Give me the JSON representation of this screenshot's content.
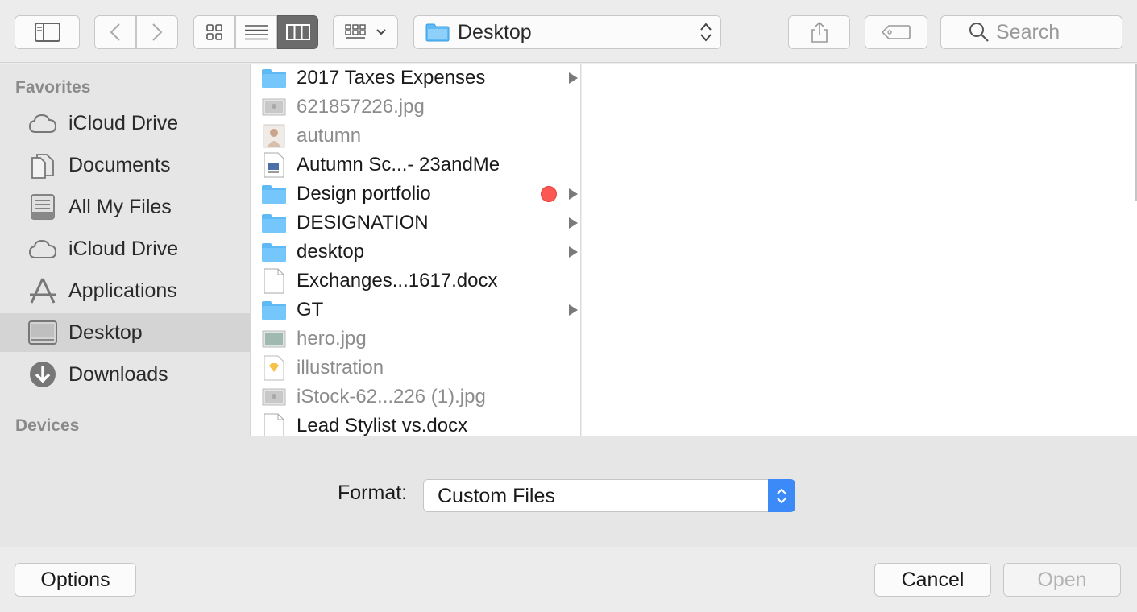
{
  "toolbar": {
    "location": "Desktop",
    "search_placeholder": "Search"
  },
  "sidebar": {
    "favorites_header": "Favorites",
    "devices_header": "Devices",
    "items": [
      {
        "label": "iCloud Drive",
        "icon": "cloud-icon"
      },
      {
        "label": "Documents",
        "icon": "documents-icon"
      },
      {
        "label": "All My Files",
        "icon": "all-files-icon"
      },
      {
        "label": "iCloud Drive",
        "icon": "cloud-icon"
      },
      {
        "label": "Applications",
        "icon": "applications-icon"
      },
      {
        "label": "Desktop",
        "icon": "desktop-icon",
        "selected": true
      },
      {
        "label": "Downloads",
        "icon": "downloads-icon"
      }
    ]
  },
  "files": [
    {
      "name": "2017 Taxes Expenses",
      "type": "folder",
      "enabled": true,
      "has_children": true
    },
    {
      "name": "621857226.jpg",
      "type": "image",
      "enabled": false
    },
    {
      "name": "autumn",
      "type": "portrait",
      "enabled": false
    },
    {
      "name": "Autumn Sc...- 23andMe",
      "type": "document-image",
      "enabled": true
    },
    {
      "name": "Design portfolio",
      "type": "folder",
      "enabled": true,
      "has_children": true,
      "tag_color": "#fc5753"
    },
    {
      "name": "DESIGNATION",
      "type": "folder",
      "enabled": true,
      "has_children": true
    },
    {
      "name": "desktop",
      "type": "folder",
      "enabled": true,
      "has_children": true
    },
    {
      "name": "Exchanges...1617.docx",
      "type": "document",
      "enabled": true
    },
    {
      "name": "GT",
      "type": "folder",
      "enabled": true,
      "has_children": true
    },
    {
      "name": "hero.jpg",
      "type": "image",
      "enabled": false
    },
    {
      "name": "illustration",
      "type": "sketch",
      "enabled": false
    },
    {
      "name": "iStock-62...226 (1).jpg",
      "type": "image",
      "enabled": false
    },
    {
      "name": "Lead Stylist vs.docx",
      "type": "document",
      "enabled": true
    }
  ],
  "accessory": {
    "format_label": "Format:",
    "format_value": "Custom Files"
  },
  "buttons": {
    "options": "Options",
    "cancel": "Cancel",
    "open": "Open"
  },
  "colors": {
    "folder": "#5fb9f5",
    "accent": "#3c8af7",
    "tag_red": "#fc5753"
  }
}
